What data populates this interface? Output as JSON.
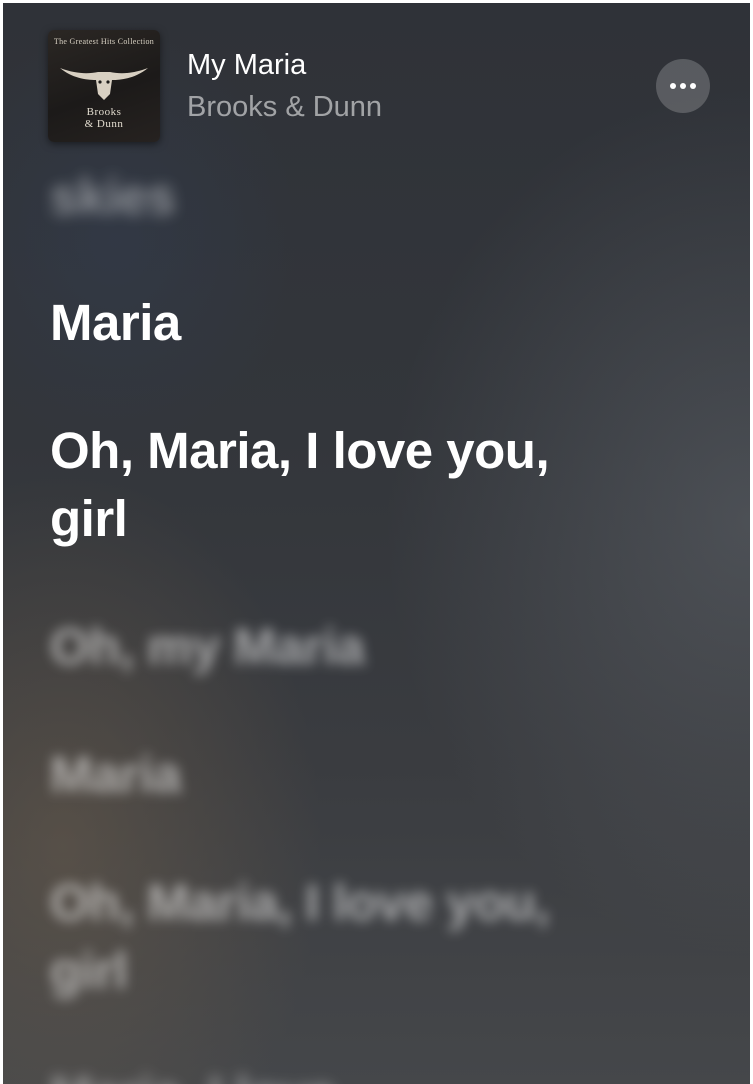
{
  "now_playing": {
    "title": "My Maria",
    "artist": "Brooks & Dunn",
    "album_art": {
      "top_text": "The Greatest Hits Collection",
      "bottom_text_line1": "Brooks",
      "bottom_text_line2": "& Dunn"
    },
    "more_icon": "ellipsis-icon"
  },
  "lyrics": {
    "previous_line": "skies",
    "active_lines": [
      "Maria",
      "Oh, Maria, I love you, girl"
    ],
    "upcoming_lines": [
      "Oh, my Maria",
      "Maria",
      "Oh, Maria, I love you, girl",
      "Maria, I love"
    ]
  },
  "colors": {
    "active_lyric": "#ffffff",
    "secondary_text": "#a7a9ad",
    "button_fill": "#5a5c61"
  }
}
